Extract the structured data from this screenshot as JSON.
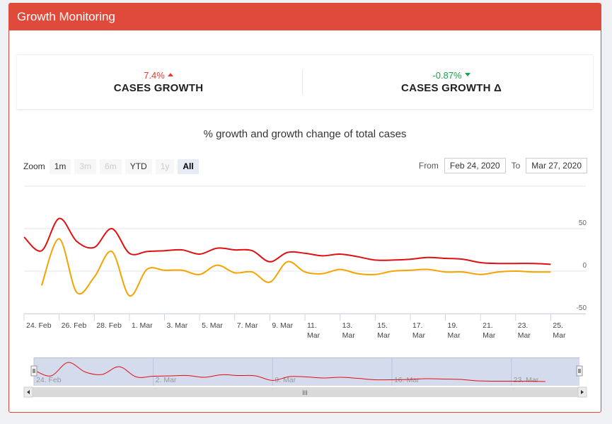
{
  "header": {
    "title": "Growth Monitoring"
  },
  "stats": [
    {
      "value": "7.4%",
      "label": "CASES GROWTH",
      "direction": "up",
      "color": "#e53935"
    },
    {
      "value": "-0.87%",
      "label": "CASES GROWTH Δ",
      "direction": "down",
      "color": "#1aa34a"
    }
  ],
  "range_selector": {
    "zoom_label": "Zoom",
    "buttons": [
      {
        "label": "1m",
        "state": "normal"
      },
      {
        "label": "3m",
        "state": "disabled"
      },
      {
        "label": "6m",
        "state": "disabled"
      },
      {
        "label": "YTD",
        "state": "normal"
      },
      {
        "label": "1y",
        "state": "disabled"
      },
      {
        "label": "All",
        "state": "active"
      }
    ],
    "from_label": "From",
    "from_value": "Feb 24, 2020",
    "to_label": "To",
    "to_value": "Mar 27, 2020"
  },
  "chart_data": {
    "type": "line",
    "title": "% growth and growth change of total cases",
    "x_start": "2020-02-24",
    "x_end": "2020-03-27",
    "x_tick_labels": [
      "24. Feb",
      "26. Feb",
      "28. Feb",
      "1. Mar",
      "3. Mar",
      "5. Mar",
      "7. Mar",
      "9. Mar",
      "11. Mar",
      "13. Mar",
      "15. Mar",
      "17. Mar",
      "19. Mar",
      "21. Mar",
      "23. Mar",
      "25. Mar"
    ],
    "y_tick_labels": [
      "50",
      "0",
      "-50"
    ],
    "ylim": [
      -50,
      50
    ],
    "grid": true,
    "series": [
      {
        "color": "#e01010",
        "points": [
          [
            "2020-02-24",
            40
          ],
          [
            "2020-02-25",
            24
          ],
          [
            "2020-02-26",
            62
          ],
          [
            "2020-02-27",
            35
          ],
          [
            "2020-02-28",
            28
          ],
          [
            "2020-02-29",
            50
          ],
          [
            "2020-03-01",
            21
          ],
          [
            "2020-03-02",
            23
          ],
          [
            "2020-03-03",
            24
          ],
          [
            "2020-03-04",
            25
          ],
          [
            "2020-03-05",
            20
          ],
          [
            "2020-03-06",
            27
          ],
          [
            "2020-03-07",
            25
          ],
          [
            "2020-03-08",
            24
          ],
          [
            "2020-03-09",
            11
          ],
          [
            "2020-03-10",
            22
          ],
          [
            "2020-03-11",
            21
          ],
          [
            "2020-03-12",
            18
          ],
          [
            "2020-03-13",
            20
          ],
          [
            "2020-03-14",
            17
          ],
          [
            "2020-03-15",
            13
          ],
          [
            "2020-03-16",
            13
          ],
          [
            "2020-03-17",
            14
          ],
          [
            "2020-03-18",
            16
          ],
          [
            "2020-03-19",
            15
          ],
          [
            "2020-03-20",
            14
          ],
          [
            "2020-03-21",
            10
          ],
          [
            "2020-03-22",
            9
          ],
          [
            "2020-03-23",
            9
          ],
          [
            "2020-03-24",
            9
          ],
          [
            "2020-03-25",
            8
          ]
        ]
      },
      {
        "color": "#f5a300",
        "points": [
          [
            "2020-02-25",
            -17
          ],
          [
            "2020-02-26",
            38
          ],
          [
            "2020-02-27",
            -25
          ],
          [
            "2020-02-28",
            -7
          ],
          [
            "2020-02-29",
            23
          ],
          [
            "2020-03-01",
            -29
          ],
          [
            "2020-03-02",
            2
          ],
          [
            "2020-03-03",
            1
          ],
          [
            "2020-03-04",
            1
          ],
          [
            "2020-03-05",
            -4
          ],
          [
            "2020-03-06",
            7
          ],
          [
            "2020-03-07",
            -2
          ],
          [
            "2020-03-08",
            -1
          ],
          [
            "2020-03-09",
            -13
          ],
          [
            "2020-03-10",
            11
          ],
          [
            "2020-03-11",
            -1
          ],
          [
            "2020-03-12",
            -3
          ],
          [
            "2020-03-13",
            2
          ],
          [
            "2020-03-14",
            -3
          ],
          [
            "2020-03-15",
            -4
          ],
          [
            "2020-03-16",
            0
          ],
          [
            "2020-03-17",
            1
          ],
          [
            "2020-03-18",
            2
          ],
          [
            "2020-03-19",
            -1
          ],
          [
            "2020-03-20",
            -1
          ],
          [
            "2020-03-21",
            -4
          ],
          [
            "2020-03-22",
            -1
          ],
          [
            "2020-03-23",
            0
          ],
          [
            "2020-03-24",
            -1
          ],
          [
            "2020-03-25",
            -1
          ]
        ]
      }
    ],
    "navigator": {
      "tick_labels": [
        "24. Feb",
        "2. Mar",
        "9. Mar",
        "16. Mar",
        "23. Mar"
      ],
      "scrollbar_grip": "III"
    }
  }
}
